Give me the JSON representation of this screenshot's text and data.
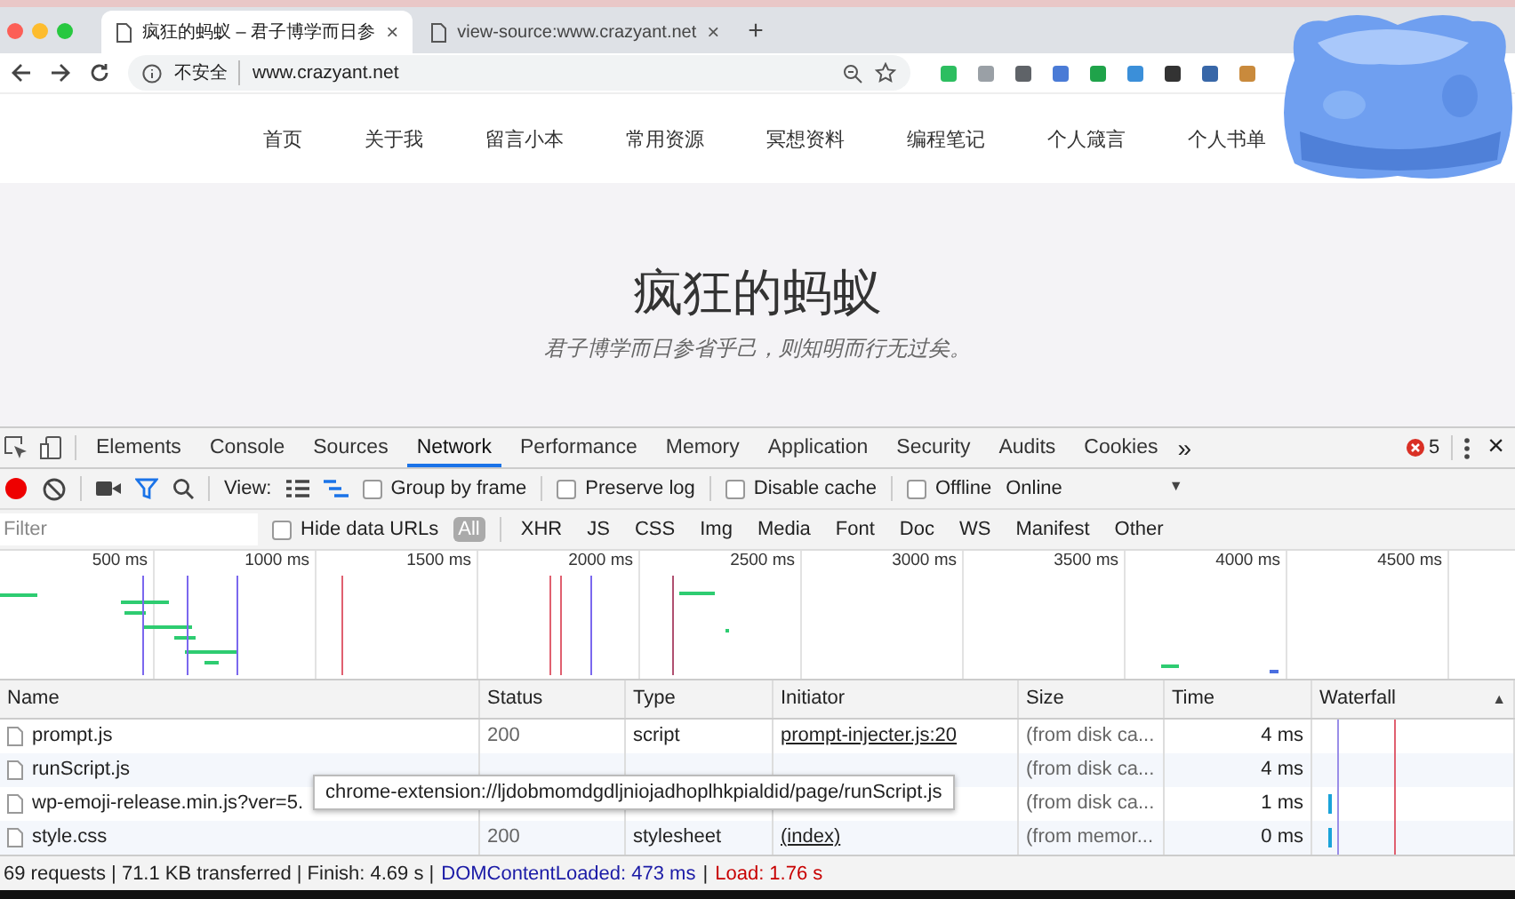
{
  "browser": {
    "tabs": [
      {
        "title": "疯狂的蚂蚁 – 君子博学而日参",
        "selected": true,
        "close": "×"
      },
      {
        "title": "view-source:www.crazyant.net",
        "selected": false,
        "close": "×"
      }
    ],
    "new_tab": "+",
    "security": "不安全",
    "url": "www.crazyant.net"
  },
  "site": {
    "nav": [
      "首页",
      "关于我",
      "留言小本",
      "常用资源",
      "冥想资料",
      "编程笔记",
      "个人箴言",
      "个人书单"
    ],
    "title": "疯狂的蚂蚁",
    "subtitle": "君子博学而日参省乎己，则知明而行无过矣。"
  },
  "devtools": {
    "panels": [
      {
        "label": "Elements",
        "selected": false
      },
      {
        "label": "Console",
        "selected": false
      },
      {
        "label": "Sources",
        "selected": false
      },
      {
        "label": "Network",
        "selected": true
      },
      {
        "label": "Performance",
        "selected": false
      },
      {
        "label": "Memory",
        "selected": false
      },
      {
        "label": "Application",
        "selected": false
      },
      {
        "label": "Security",
        "selected": false
      },
      {
        "label": "Audits",
        "selected": false
      },
      {
        "label": "Cookies",
        "selected": false
      }
    ],
    "more": "»",
    "error_count": "5",
    "close": "×",
    "toolbar": {
      "recording": true,
      "view_label": "View:",
      "checkboxes": [
        {
          "label": "Group by frame",
          "checked": false
        },
        {
          "label": "Preserve log",
          "checked": false
        },
        {
          "label": "Disable cache",
          "checked": false
        },
        {
          "label": "Offline",
          "checked": false
        }
      ],
      "throttle": "Online",
      "throttle_arrow": "▼"
    },
    "filter": {
      "placeholder": "Filter",
      "hide_data_urls": {
        "label": "Hide data URLs",
        "checked": false
      },
      "types": [
        {
          "label": "All",
          "selected": true
        },
        {
          "label": "XHR",
          "selected": false
        },
        {
          "label": "JS",
          "selected": false
        },
        {
          "label": "CSS",
          "selected": false
        },
        {
          "label": "Img",
          "selected": false
        },
        {
          "label": "Media",
          "selected": false
        },
        {
          "label": "Font",
          "selected": false
        },
        {
          "label": "Doc",
          "selected": false
        },
        {
          "label": "WS",
          "selected": false
        },
        {
          "label": "Manifest",
          "selected": false
        },
        {
          "label": "Other",
          "selected": false
        }
      ]
    },
    "overview": {
      "ticks": [
        "500 ms",
        "1000 ms",
        "1500 ms",
        "2000 ms",
        "2500 ms",
        "3000 ms",
        "3500 ms",
        "4000 ms",
        "4500 ms"
      ]
    },
    "table": {
      "columns": [
        "Name",
        "Status",
        "Type",
        "Initiator",
        "Size",
        "Time",
        "Waterfall"
      ],
      "sort_indicator": "▲",
      "rows": [
        {
          "name": "prompt.js",
          "status": "200",
          "type": "script",
          "initiator": "prompt-injecter.js:20",
          "size": "(from disk ca...",
          "time": "4 ms",
          "bar": false
        },
        {
          "name": "runScript.js",
          "size": "(from disk ca...",
          "time": "4 ms",
          "bar": false
        },
        {
          "name": "wp-emoji-release.min.js?ver=5.",
          "size": "(from disk ca...",
          "time": "1 ms",
          "bar": true
        },
        {
          "name": "style.css",
          "status": "200",
          "type": "stylesheet",
          "initiator": "(index)",
          "size": "(from memor...",
          "time": "0 ms",
          "bar": true
        }
      ]
    },
    "tooltip": "chrome-extension://ljdobmomdgdljniojadhoplhkpialdid/page/runScript.js",
    "status_bar": {
      "summary": "69 requests | 71.1 KB transferred | Finish: 4.69 s |",
      "dcl": "DOMContentLoaded: 473 ms",
      "separator": "|",
      "load": "Load: 1.76 s"
    }
  }
}
